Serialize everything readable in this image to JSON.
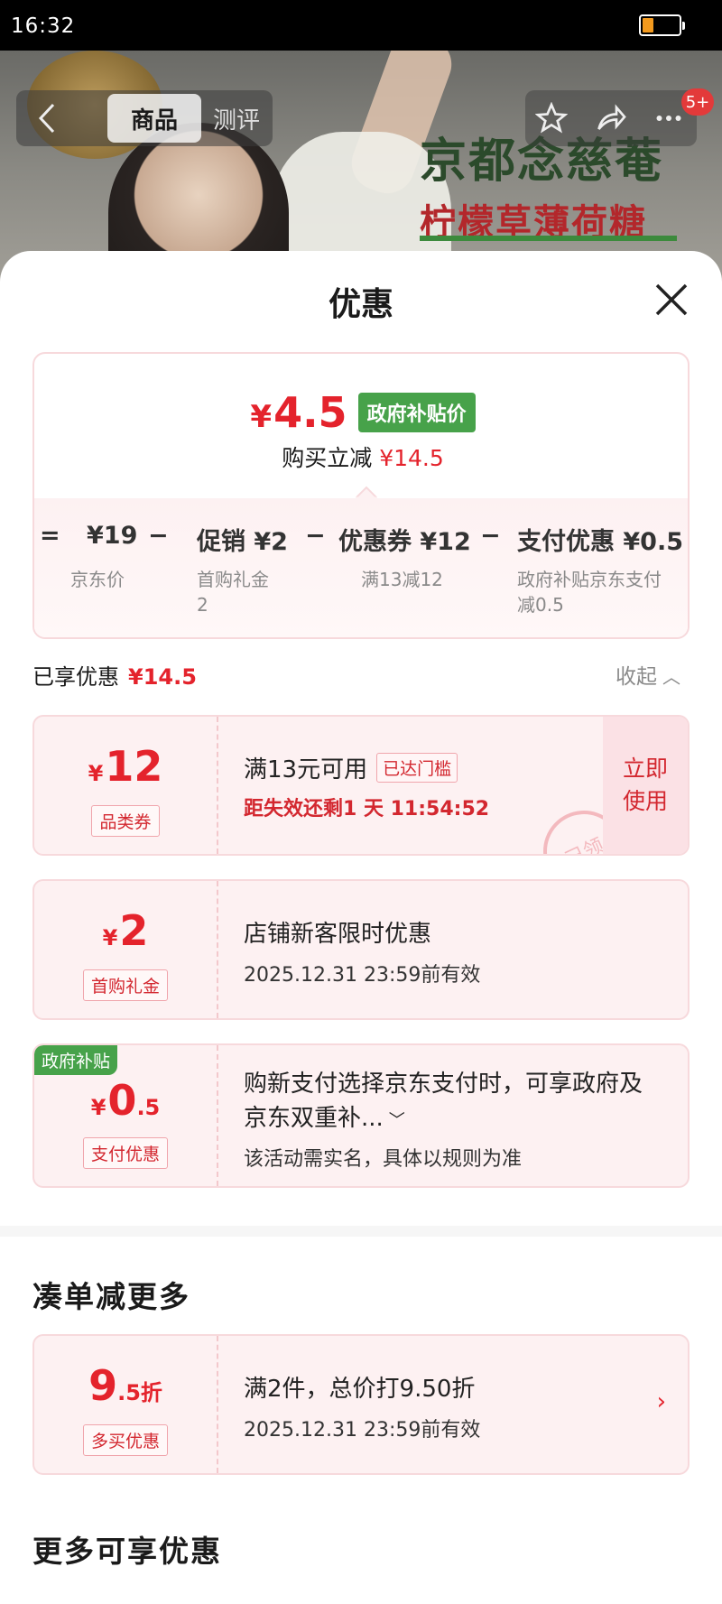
{
  "status_bar": {
    "time": "16:32",
    "battery_color": "#f39a1e",
    "battery_level": 0.3
  },
  "header": {
    "tabs": [
      "商品",
      "测评"
    ],
    "badge": "5+",
    "product_title_line1": "京都念慈菴",
    "product_title_line2": "柠檬草薄荷糖"
  },
  "sheet": {
    "title": "优惠",
    "summary": {
      "price": "4.5",
      "currency": "¥",
      "gov_badge": "政府补贴价",
      "instant_label": "购买立减",
      "instant_amount": "¥14.5",
      "calc": [
        {
          "op": "=",
          "value": "¥19",
          "desc": "京东价"
        },
        {
          "op": "−",
          "value": "促销 ¥2",
          "desc": "首购礼金\n2"
        },
        {
          "op": "−",
          "value": "优惠券 ¥12",
          "desc": "满13减12"
        },
        {
          "op": "−",
          "value": "支付优惠 ¥0.5",
          "desc": "政府补贴京东支付\n减0.5"
        }
      ]
    },
    "enjoyed": {
      "label": "已享优惠",
      "amount": "¥14.5",
      "collapse": "收起"
    },
    "coupons": [
      {
        "currency": "¥",
        "amount": "12",
        "tag": "品类券",
        "title": "满13元可用",
        "threshold": "已达门槛",
        "countdown": "距失效还剩1 天 11:54:52",
        "button": "立即\n使用",
        "stamp": "已领"
      },
      {
        "currency": "¥",
        "amount": "2",
        "tag": "首购礼金",
        "title": "店铺新客限时优惠",
        "validity": "2025.12.31 23:59前有效"
      },
      {
        "corner": "政府补贴",
        "currency": "¥",
        "amount": "0",
        "decimal": ".5",
        "tag": "支付优惠",
        "title": "购新支付选择京东支付时，可享政府及京东双重补...",
        "note": "该活动需实名，具体以规则为准"
      }
    ],
    "more_section": {
      "title": "凑单减更多",
      "card": {
        "amount": "9",
        "decimal": ".5折",
        "tag": "多买优惠",
        "title": "满2件，总价打9.50折",
        "validity": "2025.12.31 23:59前有效"
      }
    },
    "more_available_title": "更多可享优惠"
  },
  "colors": {
    "accent": "#e4232c",
    "gov_green": "#47a24a",
    "card_bg": "#fdf1f2"
  }
}
